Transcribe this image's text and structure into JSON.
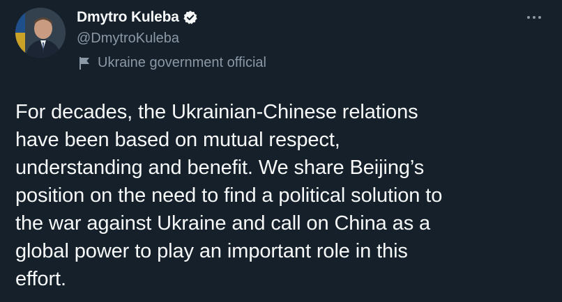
{
  "author": {
    "display_name": "Dmytro Kuleba",
    "handle": "@DmytroKuleba",
    "label": "Ukraine government official",
    "verified": true
  },
  "icons": {
    "verified": "verified-badge-icon",
    "label": "flag-icon",
    "menu": "more-options-icon"
  },
  "tweet": {
    "text": "For decades, the Ukrainian-Chinese relations\nhave been based on mutual respect,\nunderstanding and benefit. We share Beijing’s\nposition on the need to find a political solution to\nthe war against Ukraine and call on China as a\nglobal power to play an important role in this\neffort."
  },
  "colors": {
    "background": "#15202b",
    "primary_text": "#f7f9f9",
    "secondary_text": "#8b98a5"
  }
}
